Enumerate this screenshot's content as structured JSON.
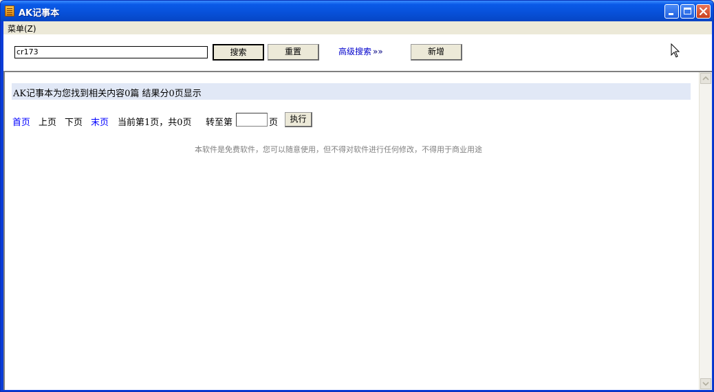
{
  "window": {
    "title": "AK记事本"
  },
  "menu": {
    "items": [
      {
        "label": "菜单(Z)"
      }
    ]
  },
  "toolbar": {
    "search_value": "cr173",
    "search_label": "搜索",
    "reset_label": "重置",
    "advanced_label": "高级搜索",
    "advanced_chevrons": "»»",
    "new_label": "新增"
  },
  "results": {
    "summary": "AK记事本为您找到相关内容0篇 结果分0页显示"
  },
  "pager": {
    "first": "首页",
    "prev": "上页",
    "next": "下页",
    "last": "末页",
    "current": "当前第1页，共0页",
    "goto_prefix": "转至第",
    "goto_suffix": "页",
    "goto_value": "",
    "exec_label": "执行"
  },
  "footer": {
    "note": "本软件是免费软件，您可以随意使用，但不得对软件进行任何修改，不得用于商业用途"
  }
}
